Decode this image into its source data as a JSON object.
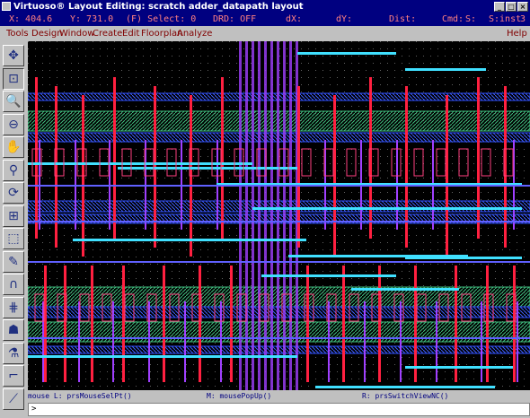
{
  "window": {
    "title": "Virtuoso® Layout Editing: scratch adder_datapath layout"
  },
  "status": {
    "x": "X: 404.6",
    "y": "Y: 731.0",
    "select": "(F) Select: 0",
    "drd": "DRD: OFF",
    "dx": "dX:",
    "dy": "dY:",
    "dist": "Dist:",
    "cmd": "Cmd:",
    "s": "S:",
    "sinst": "S:inst",
    "count": "3"
  },
  "menu": {
    "tools": "Tools",
    "design": "Design",
    "window": "Window",
    "create": "Create",
    "edit": "Edit",
    "floorplan": "Floorplan",
    "analyze": "Analyze",
    "help": "Help"
  },
  "toolbar": [
    {
      "name": "pan-icon",
      "glyph": "✥"
    },
    {
      "name": "zoom-fit-icon",
      "glyph": "⊡"
    },
    {
      "name": "zoom-in-icon",
      "glyph": "🔍"
    },
    {
      "name": "zoom-out-icon",
      "glyph": "⊖"
    },
    {
      "name": "hand-icon",
      "glyph": "✋"
    },
    {
      "name": "zoom-area-icon",
      "glyph": "⚲"
    },
    {
      "name": "redraw-icon",
      "glyph": "⟳"
    },
    {
      "name": "ruler-icon",
      "glyph": "⊞"
    },
    {
      "name": "select-area-icon",
      "glyph": "⬚"
    },
    {
      "name": "pencil-icon",
      "glyph": "✎"
    },
    {
      "name": "path-icon",
      "glyph": "∩"
    },
    {
      "name": "grid-icon",
      "glyph": "⋕"
    },
    {
      "name": "hierarchy-icon",
      "glyph": "☗"
    },
    {
      "name": "probe-icon",
      "glyph": "⚗"
    },
    {
      "name": "wire-icon",
      "glyph": "⌐"
    },
    {
      "name": "stretch-icon",
      "glyph": "⟋"
    }
  ],
  "mouse": {
    "left": "mouse L: prsMouseSelPt()",
    "middle": "M: mousePopUp()",
    "right": "R: prsSwitchViewNC()"
  },
  "prompt": ">"
}
